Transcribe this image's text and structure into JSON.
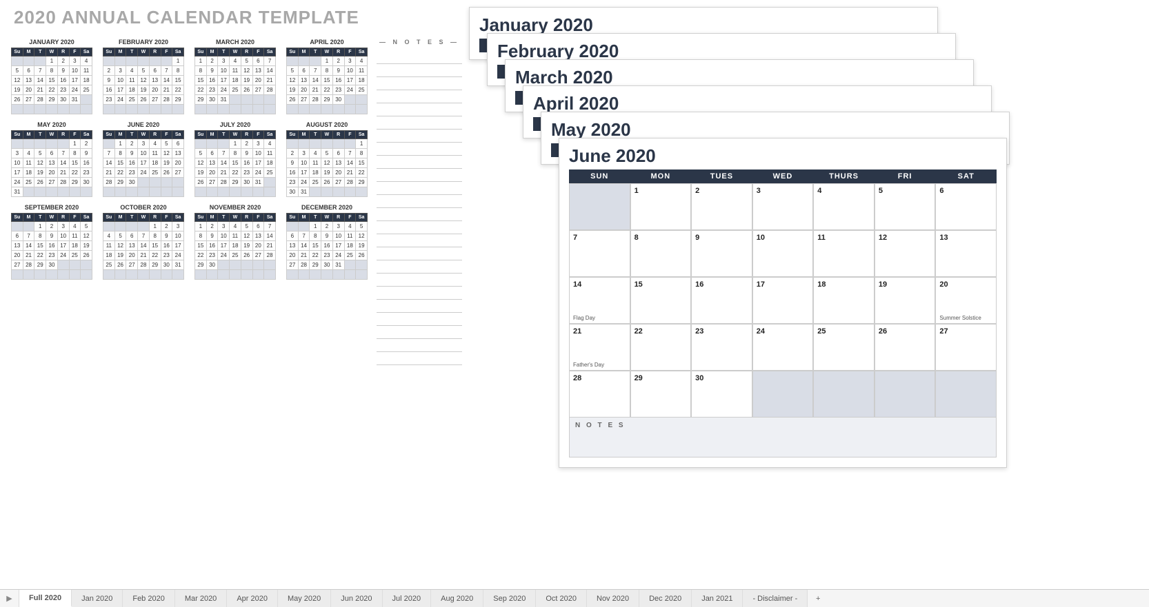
{
  "title": "2020 ANNUAL CALENDAR TEMPLATE",
  "notes_label": "— N O T E S —",
  "day_abbrev": [
    "Su",
    "M",
    "T",
    "W",
    "R",
    "F",
    "Sa"
  ],
  "day_long": [
    "SUN",
    "MON",
    "TUES",
    "WED",
    "THURS",
    "FRI",
    "SAT"
  ],
  "months": [
    {
      "name": "JANUARY 2020",
      "start": 3,
      "days": 31
    },
    {
      "name": "FEBRUARY 2020",
      "start": 6,
      "days": 29
    },
    {
      "name": "MARCH 2020",
      "start": 0,
      "days": 31
    },
    {
      "name": "APRIL 2020",
      "start": 3,
      "days": 30
    },
    {
      "name": "MAY 2020",
      "start": 5,
      "days": 31
    },
    {
      "name": "JUNE 2020",
      "start": 1,
      "days": 30
    },
    {
      "name": "JULY 2020",
      "start": 3,
      "days": 31
    },
    {
      "name": "AUGUST 2020",
      "start": 6,
      "days": 31
    },
    {
      "name": "SEPTEMBER 2020",
      "start": 2,
      "days": 30
    },
    {
      "name": "OCTOBER 2020",
      "start": 4,
      "days": 31
    },
    {
      "name": "NOVEMBER 2020",
      "start": 0,
      "days": 30
    },
    {
      "name": "DECEMBER 2020",
      "start": 2,
      "days": 31
    }
  ],
  "stack_sheets": [
    "January 2020",
    "February 2020",
    "March 2020",
    "April 2020",
    "May 2020"
  ],
  "top_sheet": {
    "title": "June 2020",
    "start": 1,
    "days": 30,
    "events": {
      "14": "Flag Day",
      "20": "Summer Solstice",
      "21": "Father's Day"
    },
    "notes_label": "N O T E S"
  },
  "tabs": [
    "Full 2020",
    "Jan 2020",
    "Feb 2020",
    "Mar 2020",
    "Apr 2020",
    "May 2020",
    "Jun 2020",
    "Jul 2020",
    "Aug 2020",
    "Sep 2020",
    "Oct 2020",
    "Nov 2020",
    "Dec 2020",
    "Jan 2021",
    "- Disclaimer -"
  ],
  "active_tab": 0,
  "notes_lines": 24
}
